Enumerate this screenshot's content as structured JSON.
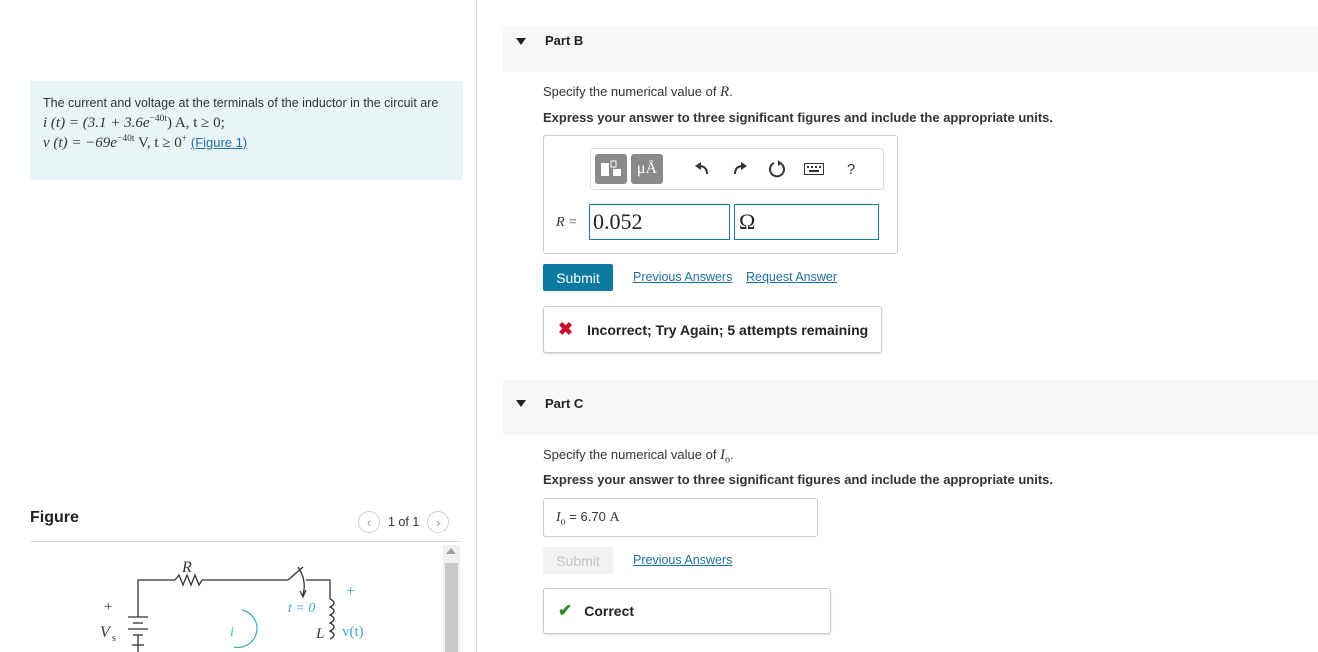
{
  "problem": {
    "intro": "The current and voltage at the terminals of the inductor in the circuit are",
    "eq1": "i (t) = (3.1 + 3.6e",
    "eq1_exp": "−40t",
    "eq1_tail": ") A, t ≥ 0;",
    "eq2": "v (t) = −69e",
    "eq2_exp": "−40t",
    "eq2_tail": " V, t ≥ 0",
    "eq2_sup": "+",
    "figure_link": "(Figure 1)"
  },
  "figure": {
    "title": "Figure",
    "pager_text": "1 of 1",
    "prev_icon": "chevron-left-icon",
    "next_icon": "chevron-right-icon",
    "circuit": {
      "resistor_label": "R",
      "source_label": "V",
      "source_sub": "s",
      "plus": "+",
      "current_label": "i",
      "switch_label": "t = 0",
      "inductor_label": "L",
      "voltage_label": "v(t)",
      "vplus": "+"
    }
  },
  "part_b": {
    "label": "Part B",
    "spec_prefix": "Specify the numerical value of ",
    "spec_var": "R",
    "spec_suffix": ".",
    "express": "Express your answer to three significant figures and include the appropriate units.",
    "toolbar": {
      "template_icon": "template-icon",
      "units_label": "μÅ",
      "undo_icon": "undo-icon",
      "redo_icon": "redo-icon",
      "reset_icon": "reset-icon",
      "keyboard_icon": "keyboard-icon",
      "help_label": "?"
    },
    "var_label": "R =",
    "value": "0.052",
    "unit": "Ω",
    "submit_label": "Submit",
    "previous_answers": "Previous Answers",
    "request_answer": "Request Answer",
    "feedback": "Incorrect; Try Again; 5 attempts remaining",
    "feedback_color": "#c8102e"
  },
  "part_c": {
    "label": "Part C",
    "spec_prefix": "Specify the numerical value of ",
    "spec_var": "I",
    "spec_var_sub": "o",
    "spec_suffix": ".",
    "express": "Express your answer to three significant figures and include the appropriate units.",
    "answer_var": "I",
    "answer_var_sub": "o",
    "answer_eq": " = ",
    "answer_value": "6.70",
    "answer_unit": "A",
    "submit_label": "Submit",
    "previous_answers": "Previous Answers",
    "feedback": "Correct",
    "feedback_color": "#2e8b2e"
  },
  "colors": {
    "accent": "#0c7aa0",
    "problem_bg": "#e9f4f6",
    "circuit_blue": "#3aa7c9"
  }
}
